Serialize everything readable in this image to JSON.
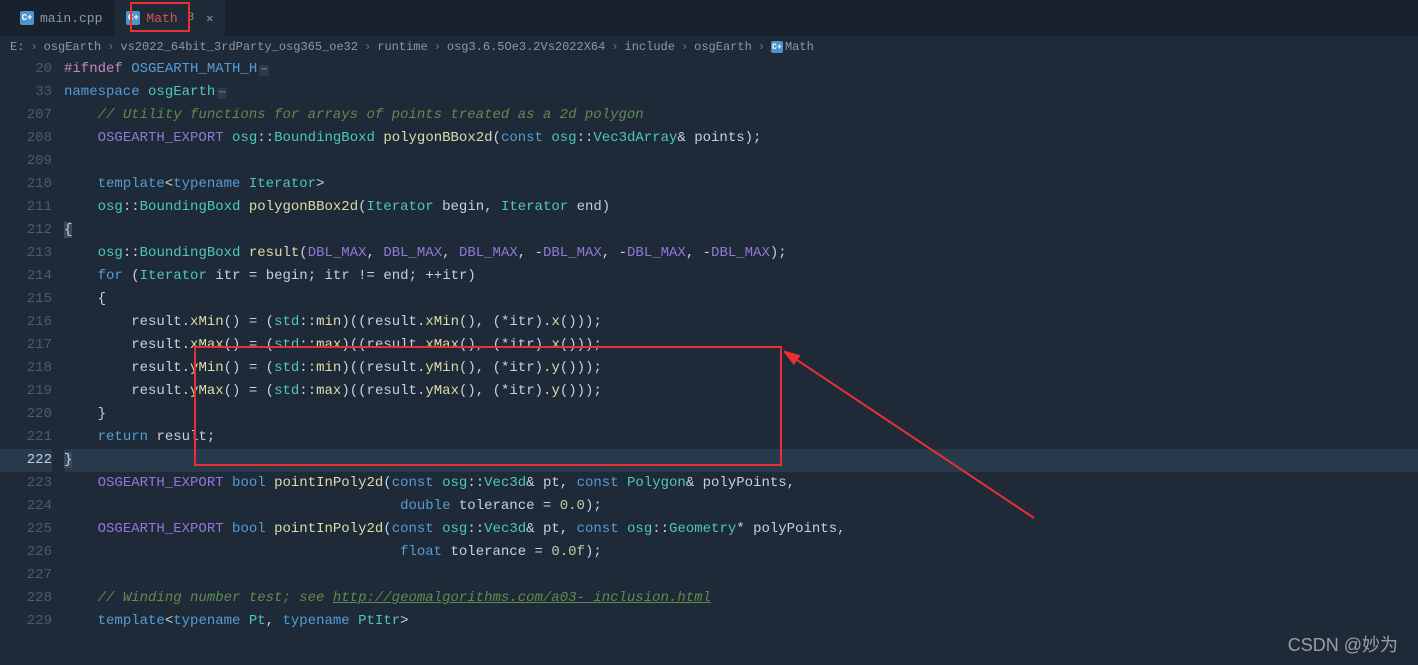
{
  "tabs": [
    {
      "label": "main.cpp",
      "active": false
    },
    {
      "label": "Math",
      "badge": "3",
      "active": true
    }
  ],
  "breadcrumb": [
    "E:",
    "osgEarth",
    "vs2022_64bit_3rdParty_osg365_oe32",
    "runtime",
    "osg3.6.5Oe3.2Vs2022X64",
    "include",
    "osgEarth",
    "Math"
  ],
  "watermark": "CSDN @妙为",
  "gutter": [
    "20",
    "33",
    "207",
    "208",
    "209",
    "210",
    "211",
    "212",
    "213",
    "214",
    "215",
    "216",
    "217",
    "218",
    "219",
    "220",
    "221",
    "222",
    "223",
    "224",
    "225",
    "226",
    "227",
    "228",
    "229",
    ""
  ],
  "code": {
    "l20_ifndef": "#ifndef",
    "l20_mac": "OSGEARTH_MATH_H",
    "l33_ns_kw": "namespace",
    "l33_ns": "osgEarth",
    "l207_cmt": "// Utility functions for arrays of points treated as a 2d polygon",
    "l208_mac": "OSGEARTH_EXPORT",
    "l208_osg": "osg",
    "l208_bb": "BoundingBoxd",
    "l208_fn": "polygonBBox2d",
    "l208_const": "const",
    "l208_v3a": "Vec3dArray",
    "l208_pts": "points",
    "l210_tmpl": "template",
    "l210_tn": "typename",
    "l210_it": "Iterator",
    "l211_osg": "osg",
    "l211_bb": "BoundingBoxd",
    "l211_fn": "polygonBBox2d",
    "l211_it1": "Iterator",
    "l211_begin": "begin",
    "l211_it2": "Iterator",
    "l211_end": "end",
    "l213_osg": "osg",
    "l213_bb": "BoundingBoxd",
    "l213_res": "result",
    "l213_dbl": "DBL_MAX",
    "l214_for": "for",
    "l214_it": "Iterator",
    "l214_itr": "itr",
    "l214_begin": "begin",
    "l214_end": "end",
    "l214_inc": "itr",
    "l216_res": "result",
    "l216_min": "xMin",
    "l216_std": "std",
    "l216_fn": "min",
    "l216_itr": "itr",
    "l216_x": "x",
    "l217_res": "result",
    "l217_max": "xMax",
    "l217_std": "std",
    "l217_fn": "max",
    "l217_itr": "itr",
    "l217_x": "x",
    "l218_res": "result",
    "l218_min": "yMin",
    "l218_std": "std",
    "l218_fn": "min",
    "l218_itr": "itr",
    "l218_y": "y",
    "l219_res": "result",
    "l219_max": "yMax",
    "l219_std": "std",
    "l219_fn": "max",
    "l219_itr": "itr",
    "l219_y": "y",
    "l221_ret": "return",
    "l221_res": "result",
    "l223_mac": "OSGEARTH_EXPORT",
    "l223_bool": "bool",
    "l223_fn": "pointInPoly2d",
    "l223_const1": "const",
    "l223_osg1": "osg",
    "l223_v3": "Vec3d",
    "l223_pt": "pt",
    "l223_const2": "const",
    "l223_poly": "Polygon",
    "l223_pp": "polyPoints",
    "l224_dbl": "double",
    "l224_tol": "tolerance",
    "l224_v": "0.0",
    "l225_mac": "OSGEARTH_EXPORT",
    "l225_bool": "bool",
    "l225_fn": "pointInPoly2d",
    "l225_const1": "const",
    "l225_osg1": "osg",
    "l225_v3": "Vec3d",
    "l225_pt": "pt",
    "l225_const2": "const",
    "l225_osg2": "osg",
    "l225_geo": "Geometry",
    "l225_pp": "polyPoints",
    "l226_flt": "float",
    "l226_tol": "tolerance",
    "l226_v": "0.0f",
    "l228_cmt1": "// Winding number test; see ",
    "l228_url": "http://geomalgorithms.com/a03-_inclusion.html",
    "l229_tmpl": "template",
    "l229_tn1": "typename",
    "l229_pt": "Pt",
    "l229_tn2": "typename",
    "l229_pti": "PtItr"
  }
}
